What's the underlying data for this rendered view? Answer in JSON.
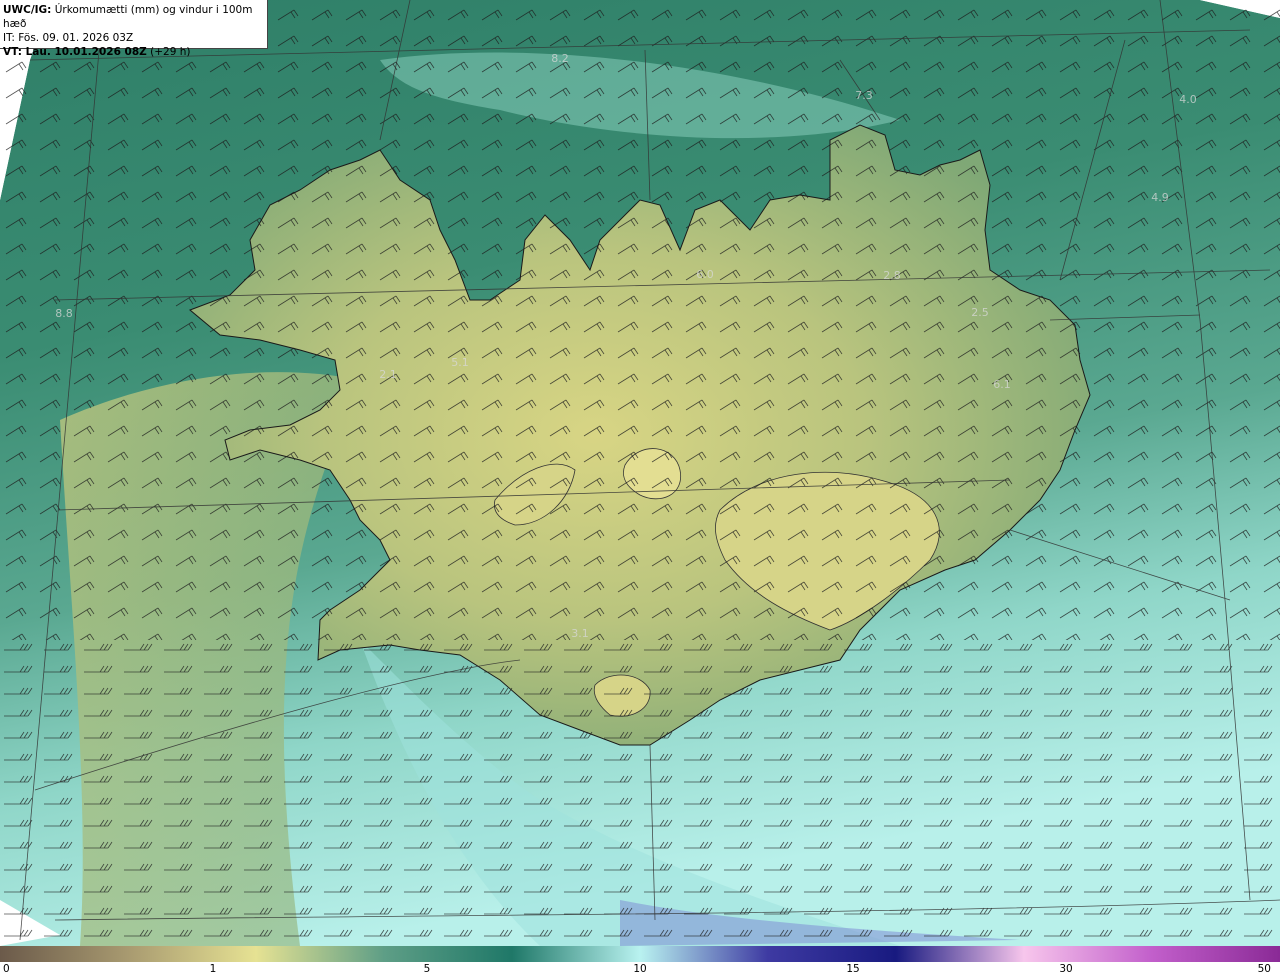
{
  "header": {
    "model": "UWC/IG:",
    "title": "Úrkomumætti (mm) og vindur i 100m hæð",
    "init_time": "IT: Fös. 09. 01. 2026 03Z",
    "valid_time": "VT: Lau. 10.01.2026 08Z",
    "lead_time": "(+29 h)"
  },
  "map_labels": [
    {
      "text": "8.2"
    },
    {
      "text": "7.3"
    },
    {
      "text": "4.0"
    },
    {
      "text": "4.9"
    },
    {
      "text": "6.0"
    },
    {
      "text": "2.8"
    },
    {
      "text": "2.5"
    },
    {
      "text": "6.1"
    },
    {
      "text": "5.1"
    },
    {
      "text": "2.1"
    },
    {
      "text": "3.1"
    },
    {
      "text": "8.8"
    }
  ],
  "colorbar": {
    "ticks": [
      "0",
      "1",
      "5",
      "10",
      "15",
      "30",
      "50"
    ],
    "colors": [
      "#6b5a4a",
      "#a89a70",
      "#e6e293",
      "#5e9e86",
      "#1f7868",
      "#b9f2f0",
      "#3e3aa2",
      "#181a80",
      "#f7c6ec",
      "#c25fcb",
      "#8a2a96"
    ]
  },
  "colors": {
    "land_high": "#d8d584",
    "land_mid": "#8fb27a",
    "sea_north": "#3a8c72",
    "sea_south": "#a8e9e2",
    "coast": "#1a1a1a",
    "grid": "#333333"
  }
}
